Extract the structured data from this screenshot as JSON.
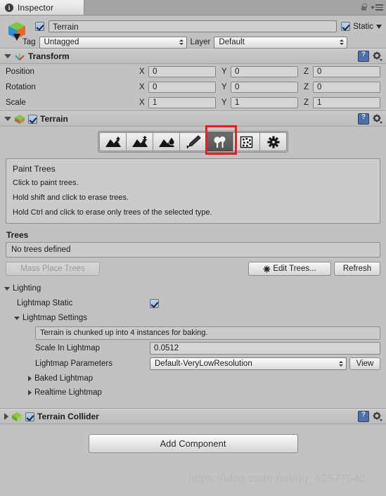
{
  "window": {
    "tab_label": "Inspector",
    "tab_icon": "info-circle-icon",
    "lock_icon": "lock-icon",
    "menu_icon": "hamburger-menu-icon"
  },
  "object_header": {
    "prefab_icon": "prefab-cube-icon",
    "enabled_checkbox": true,
    "name": "Terrain",
    "static_label": "Static",
    "static_checked": true,
    "tag_label": "Tag",
    "tag_value": "Untagged",
    "layer_label": "Layer",
    "layer_value": "Default"
  },
  "transform": {
    "title": "Transform",
    "icon": "transform-gizmo-icon",
    "help_icon": "help-book-icon",
    "gear_icon": "gear-icon",
    "rows": [
      {
        "name": "Position",
        "x": "0",
        "y": "0",
        "z": "0"
      },
      {
        "name": "Rotation",
        "x": "0",
        "y": "0",
        "z": "0"
      },
      {
        "name": "Scale",
        "x": "1",
        "y": "1",
        "z": "1"
      }
    ],
    "axis_labels": [
      "X",
      "Y",
      "Z"
    ]
  },
  "terrain": {
    "title": "Terrain",
    "icon": "terrain-cube-icon",
    "enabled_checkbox": true,
    "help_icon": "help-book-icon",
    "gear_icon": "gear-icon",
    "toolbar": [
      {
        "name": "raise-lower-terrain-tool",
        "icon": "mountain-up-arrow-icon",
        "selected": false
      },
      {
        "name": "paint-height-tool",
        "icon": "mountain-height-icon",
        "selected": false
      },
      {
        "name": "smooth-height-tool",
        "icon": "mountain-smooth-icon",
        "selected": false
      },
      {
        "name": "paint-texture-tool",
        "icon": "paintbrush-icon",
        "selected": false
      },
      {
        "name": "place-trees-tool",
        "icon": "tree-icon",
        "selected": true
      },
      {
        "name": "paint-details-tool",
        "icon": "grass-detail-icon",
        "selected": false
      },
      {
        "name": "terrain-settings-tool",
        "icon": "gear-icon",
        "selected": false
      }
    ],
    "annotation_color": "#ec1c24",
    "help": {
      "title": "Paint Trees",
      "lines": [
        "Click to paint trees.",
        "Hold shift and click to erase trees.",
        "Hold Ctrl and click to erase only trees of the selected type."
      ]
    },
    "trees_section_title": "Trees",
    "trees_status": "No trees defined",
    "mass_place_label": "Mass Place Trees",
    "mass_place_disabled": true,
    "edit_trees_label": "Edit Trees...",
    "edit_trees_icon": "gear-icon",
    "refresh_label": "Refresh"
  },
  "lighting": {
    "title": "Lighting",
    "lightmap_static_label": "Lightmap Static",
    "lightmap_static_checked": true,
    "lightmap_settings_label": "Lightmap Settings",
    "chunk_note": "Terrain is chunked up into 4 instances for baking.",
    "scale_in_lightmap_label": "Scale In Lightmap",
    "scale_in_lightmap_value": "0.0512",
    "lightmap_parameters_label": "Lightmap Parameters",
    "lightmap_parameters_value": "Default-VeryLowResolution",
    "view_button_label": "View",
    "baked_lightmap_label": "Baked Lightmap",
    "realtime_lightmap_label": "Realtime Lightmap"
  },
  "terrain_collider": {
    "title": "Terrain Collider",
    "icon": "terrain-cube-icon",
    "enabled_checkbox": true,
    "help_icon": "help-book-icon",
    "gear_icon": "gear-icon"
  },
  "footer": {
    "add_component_label": "Add Component",
    "watermark": "https://blog.csdn.net/qq_42577542"
  }
}
